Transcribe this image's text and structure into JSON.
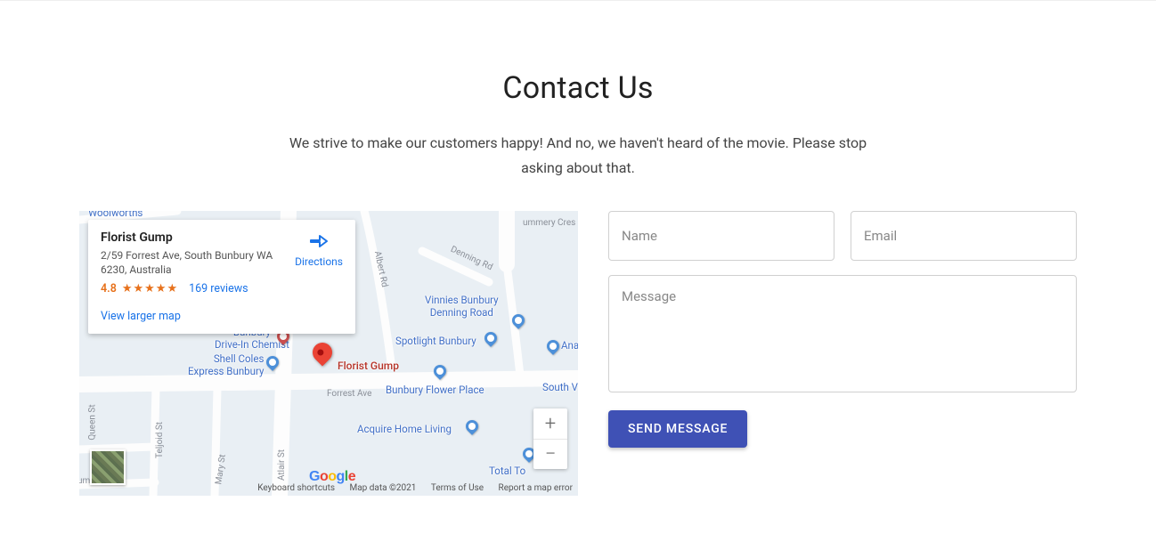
{
  "header": {
    "title": "Contact Us",
    "subtitle": "We strive to make our customers happy! And no, we haven't heard of the movie. Please stop asking about that."
  },
  "map": {
    "place_name": "Florist Gump",
    "address": "2/59 Forrest Ave, South Bunbury WA 6230, Australia",
    "rating": "4.8",
    "stars": "★★★★★",
    "reviews_text": "169 reviews",
    "directions_label": "Directions",
    "larger_map_label": "View larger map",
    "main_marker_label": "Florist Gump",
    "pois": {
      "woolworths": "Woolworths",
      "vinnies_l1": "Vinnies Bunbury",
      "vinnies_l2": "Denning Road",
      "spotlight": "Spotlight Bunbury",
      "anacond": "Anacond",
      "chemist_l1": "Bunbury",
      "chemist_l2": "Drive-In Chemist",
      "shell_l1": "Shell Coles",
      "shell_l2": "Express Bunbury",
      "flowerplace": "Bunbury Flower Place",
      "acquire": "Acquire Home Living",
      "totalto": "Total To",
      "southv": "South V"
    },
    "streets": {
      "ummery": "ummery Cres",
      "denning": "Denning Rd",
      "albert": "Albert Rd",
      "forrest": "Forrest Ave",
      "atlair": "Atlair St",
      "mary": "Mary St",
      "teljoid": "Teljoid St",
      "queen": "Queen St",
      "umba": "umba St"
    },
    "zoom_in": "+",
    "zoom_out": "−",
    "footer": {
      "shortcuts": "Keyboard shortcuts",
      "mapdata": "Map data ©2021",
      "terms": "Terms of Use",
      "report": "Report a map error"
    }
  },
  "form": {
    "name_placeholder": "Name",
    "email_placeholder": "Email",
    "message_placeholder": "Message",
    "submit_label": "SEND MESSAGE"
  }
}
